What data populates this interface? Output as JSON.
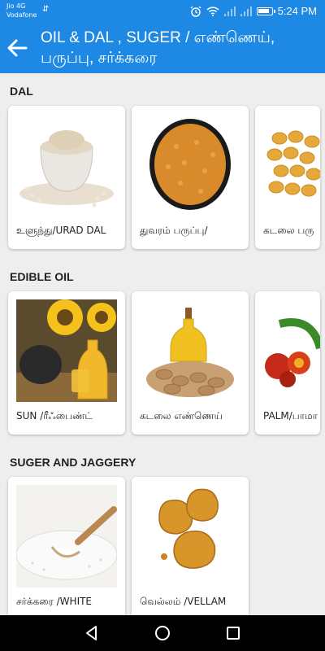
{
  "status_bar": {
    "carrier_line1": "Jio 4G",
    "carrier_line2": "Vodafone",
    "time": "5:24 PM"
  },
  "app_bar": {
    "title_line1": "OIL & DAL , SUGER / எண்ணெய்,",
    "title_line2": "பருப்பு, சர்க்கரை"
  },
  "sections": [
    {
      "title": "DAL",
      "items": [
        {
          "label": "உளுந்து/URAD DAL",
          "image": "urad-dal"
        },
        {
          "label": "துவரம் பருப்பு/",
          "image": "toor-dal"
        },
        {
          "label": "கடலை பரு",
          "image": "chana-dal"
        }
      ]
    },
    {
      "title": "EDIBLE OIL",
      "items": [
        {
          "label": "SUN /ரீஃபைண்ட்",
          "image": "sunflower-oil"
        },
        {
          "label": "கடலை எண்ணெய்",
          "image": "groundnut-oil"
        },
        {
          "label": "PALM/பாமா",
          "image": "palm-oil"
        }
      ]
    },
    {
      "title": "SUGER AND JAGGERY",
      "items": [
        {
          "label": "சர்க்கரை /WHITE",
          "image": "white-sugar"
        },
        {
          "label": "வெல்லம் /VELLAM",
          "image": "jaggery"
        }
      ]
    }
  ],
  "colors": {
    "primary": "#1e88e5",
    "background": "#eeeeee"
  }
}
